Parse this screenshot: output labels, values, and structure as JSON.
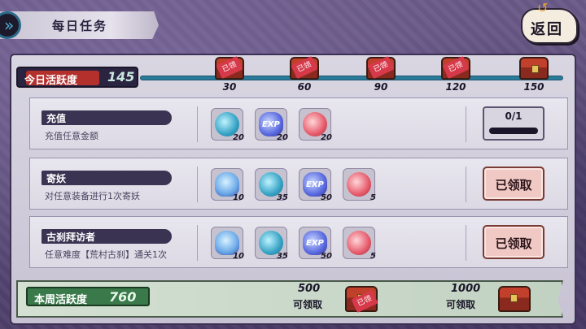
{
  "header": {
    "title": "每日任务",
    "back_label": "返回"
  },
  "daily": {
    "label": "今日活跃度",
    "value": "145",
    "milestones": [
      {
        "value": "30",
        "claimed": true,
        "stamp": "已领"
      },
      {
        "value": "60",
        "claimed": true,
        "stamp": "已领"
      },
      {
        "value": "90",
        "claimed": true,
        "stamp": "已领"
      },
      {
        "value": "120",
        "claimed": true,
        "stamp": "已领"
      },
      {
        "value": "150",
        "claimed": false,
        "stamp": ""
      }
    ]
  },
  "tasks": [
    {
      "name": "充值",
      "desc": "充值任意金额",
      "rewards": [
        {
          "icon": "soul-jade-icon",
          "qty": "20"
        },
        {
          "icon": "exp-icon",
          "qty": "20"
        },
        {
          "icon": "red-orb-icon",
          "qty": "20"
        }
      ],
      "status": "progress",
      "progress_text": "0/1",
      "progress": 0
    },
    {
      "name": "寄妖",
      "desc": "对任意装备进行1次寄妖",
      "rewards": [
        {
          "icon": "ghost-icon",
          "qty": "10"
        },
        {
          "icon": "soul-jade-icon",
          "qty": "35"
        },
        {
          "icon": "exp-icon",
          "qty": "50"
        },
        {
          "icon": "red-orb-icon",
          "qty": "5"
        }
      ],
      "status": "claimed",
      "button_label": "已领取"
    },
    {
      "name": "古刹拜访者",
      "desc": "任意难度【荒村古刹】通关1次",
      "rewards": [
        {
          "icon": "ghost-icon",
          "qty": "10"
        },
        {
          "icon": "soul-jade-icon",
          "qty": "35"
        },
        {
          "icon": "exp-icon",
          "qty": "50"
        },
        {
          "icon": "red-orb-icon",
          "qty": "5"
        }
      ],
      "status": "claimed",
      "button_label": "已领取"
    }
  ],
  "exp_text": "EXP",
  "weekly": {
    "label": "本周活跃度",
    "value": "760",
    "milestones": [
      {
        "value": "500",
        "caption": "可领取",
        "stamp": "已领"
      },
      {
        "value": "1000",
        "caption": "可领取",
        "stamp": ""
      }
    ]
  },
  "colors": {
    "accent_red": "#b3302d",
    "track_blue": "#2a7a9a",
    "weekly_green": "#3a7a4a"
  }
}
